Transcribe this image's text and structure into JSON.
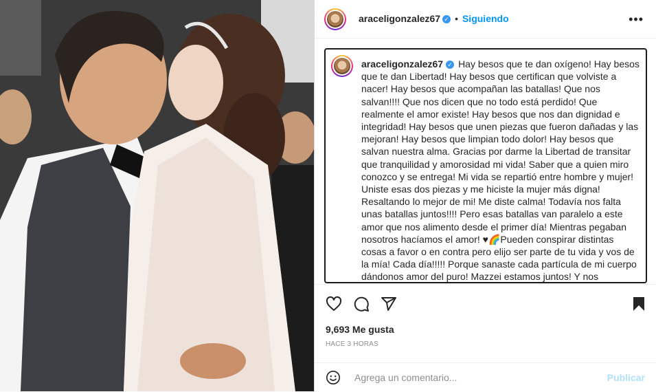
{
  "post": {
    "username": "araceligonzalez67",
    "follow_status": "Siguiendo",
    "caption": "Hay besos que te dan oxígeno! Hay besos que te dan Libertad! Hay besos que certifican que volviste a nacer! Hay besos que acompañan las batallas! Que nos salvan!!!! Que nos dicen que no todo está perdido! Que realmente el amor existe! Hay besos que nos dan dignidad e integridad! Hay besos que unen piezas que fueron dañadas y las mejoran! Hay besos que limpian todo dolor! Hay besos que salvan nuestra alma. Gracias por darme la Libertad de transitar que tranquilidad y amorosidad mi vida! Saber que a quien miro conozco y se entrega! Mi vida se repartió entre hombre y mujer! Uniste esas dos piezas y me hiciste la mujer más digna! Resaltando lo mejor de mi! Me diste calma! Todavía nos falta unas batallas juntos!!!! Pero esas batallas van paralelo a este amor que nos alimento desde el primer día! Mientras pegaban nosotros hacíamos el amor! ♥🌈Pueden conspirar distintas cosas a favor o en contra pero elijo ser parte de tu vida y vos de la mía! Cada día!!!!! Porque sanaste cada partícula de mi cuerpo dándonos amor del puro! Mazzei estamos juntos! Y nos cuidamos! Crees que eso no tiene valor? Este es mi éxito! Esta es mi visibilidad! Este es",
    "likes": "9,693 Me gusta",
    "time_ago": "HACE 3 HORAS"
  },
  "comment": {
    "placeholder": "Agrega un comentario...",
    "publish_label": "Publicar"
  },
  "icons": {
    "verified": "verified-badge-icon",
    "more": "more-options-icon",
    "like": "heart-icon",
    "comment": "comment-icon",
    "share": "share-icon",
    "save": "bookmark-icon",
    "emoji": "emoji-icon"
  },
  "colors": {
    "accent": "#0095f6",
    "verified": "#3897f0",
    "publish_disabled": "#b2dffc"
  }
}
